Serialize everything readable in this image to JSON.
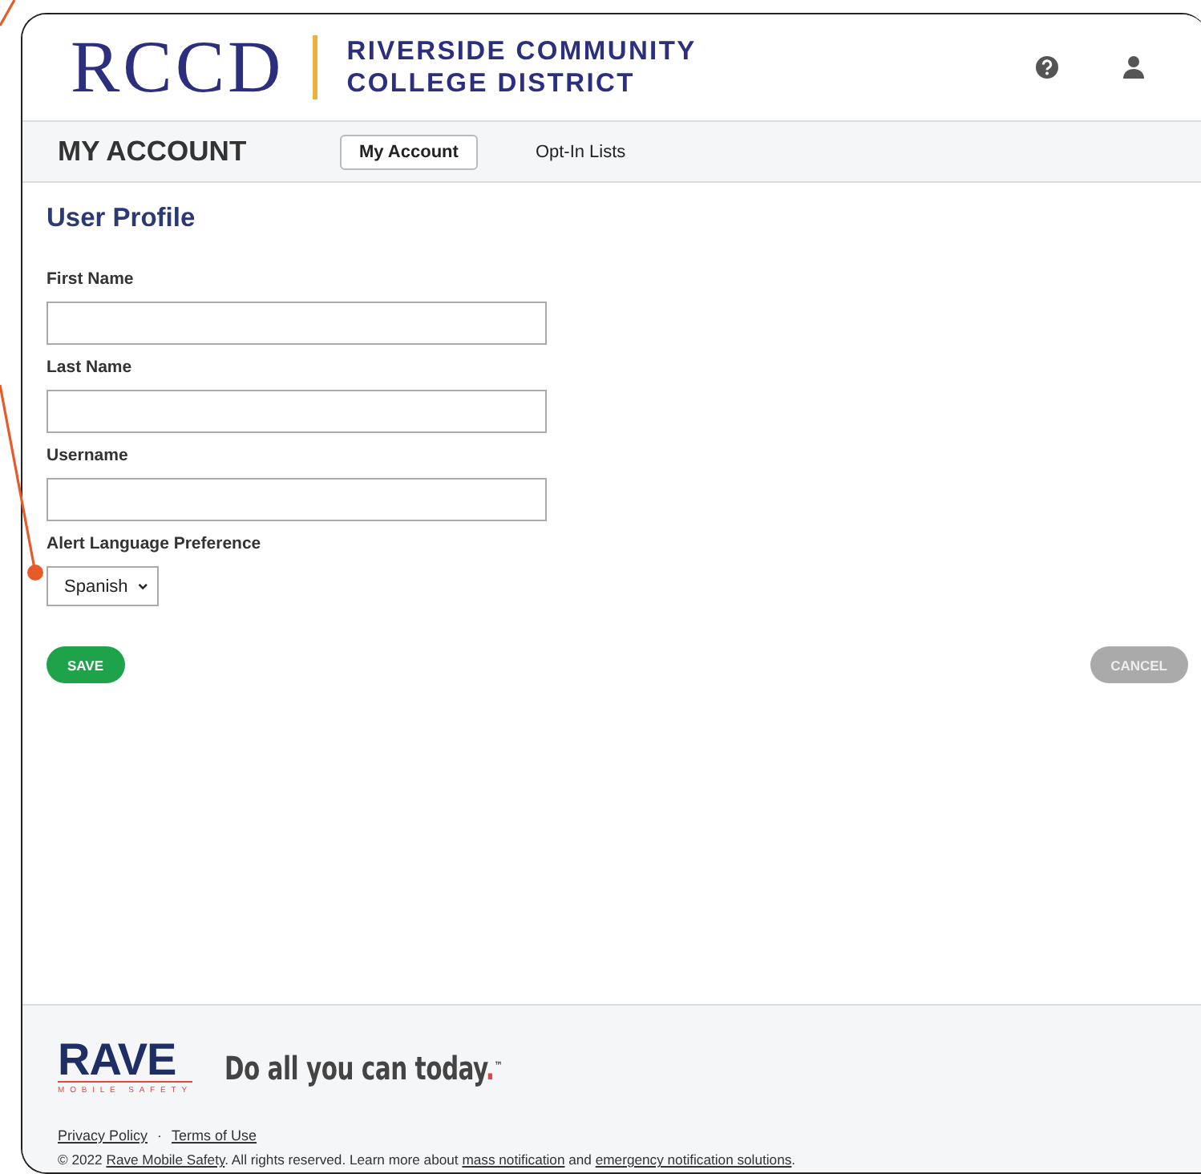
{
  "header": {
    "logo_mark": "RCCD",
    "logo_lines": [
      "RIVERSIDE COMMUNITY",
      "COLLEGE DISTRICT"
    ]
  },
  "nav": {
    "title": "MY ACCOUNT",
    "tabs": [
      {
        "label": "My Account",
        "selected": true
      },
      {
        "label": "Opt-In Lists",
        "selected": false
      }
    ]
  },
  "profile": {
    "heading": "User Profile",
    "fields": [
      {
        "label": "First Name"
      },
      {
        "label": "Last Name"
      },
      {
        "label": "Username"
      }
    ],
    "language": {
      "label": "Alert Language Preference",
      "value": "Spanish"
    },
    "buttons": [
      {
        "label": "SAVE",
        "disabled": false
      },
      {
        "label": "CANCEL",
        "disabled": true
      }
    ]
  },
  "footer": {
    "brand": "RAVE",
    "brand_sub": "MOBILE SAFETY",
    "tagline": "Do all you can today.",
    "trademark": "™",
    "links": [
      "Privacy Policy",
      "Terms of Use"
    ],
    "separator": "·",
    "copyright": [
      {
        "kind": "text",
        "text": "© 2022 "
      },
      {
        "kind": "link",
        "text": "Rave Mobile Safety"
      },
      {
        "kind": "text",
        "text": ". All rights reserved. Learn more about "
      },
      {
        "kind": "link",
        "text": "mass notification"
      },
      {
        "kind": "text",
        "text": " and "
      },
      {
        "kind": "link",
        "text": "emergency notification solutions"
      },
      {
        "kind": "text",
        "text": "."
      }
    ]
  }
}
